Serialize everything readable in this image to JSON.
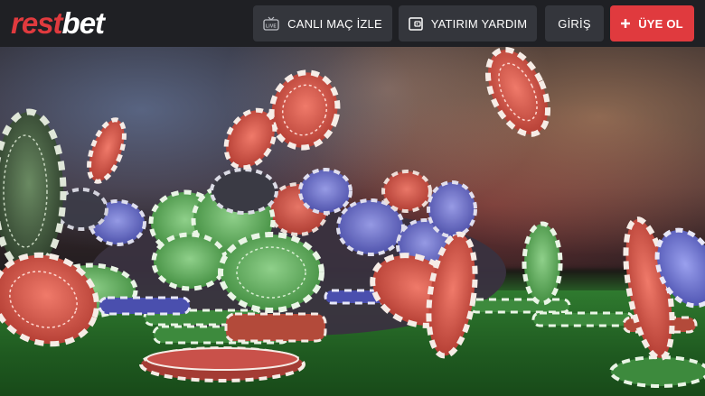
{
  "brand": {
    "logo_part1": "rest",
    "logo_part2": "bet"
  },
  "header": {
    "live_button": {
      "label": "CANLI MAÇ İZLE",
      "icon": "live-tv-icon"
    },
    "deposit_button": {
      "label": "YATIRIM YARDIM",
      "icon": "wallet-icon"
    },
    "login_button": {
      "label": "GİRİŞ"
    },
    "signup_button": {
      "label": "ÜYE OL",
      "icon": "plus-icon"
    }
  },
  "colors": {
    "header_bg": "#1f2024",
    "button_bg": "#34363c",
    "accent": "#e03a3e",
    "text": "#ffffff"
  },
  "hero": {
    "image": "casino-chips-on-green-table"
  }
}
